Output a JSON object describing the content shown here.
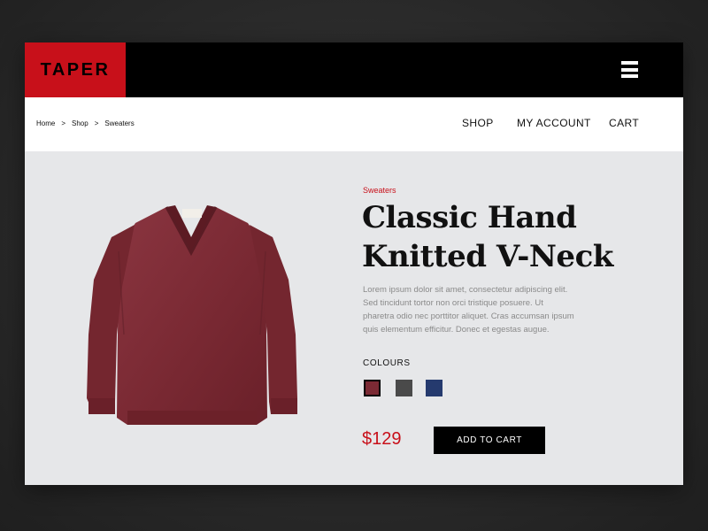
{
  "brand": {
    "logo_text": "TAPER",
    "accent_color": "#c8101a"
  },
  "header": {
    "menu_icon": "hamburger-menu-icon"
  },
  "breadcrumb": {
    "items": [
      "Home",
      "Shop",
      "Sweaters"
    ],
    "separator": ">"
  },
  "nav": {
    "items": [
      "SHOP",
      "MY ACCOUNT",
      "CART"
    ]
  },
  "product": {
    "category": "Sweaters",
    "title_line1": "Classic Hand",
    "title_line2": "Knitted V-Neck",
    "description": "Lorem ipsum dolor sit amet, consectetur adipiscing elit. Sed tincidunt tortor non orci tristique posuere. Ut pharetra odio nec porttitor aliquet. Cras accumsan ipsum quis elementum efficitur. Donec et egestas augue.",
    "colours_label": "COLOURS",
    "colours": [
      {
        "name": "burgundy",
        "hex": "#7b2a34",
        "selected": true
      },
      {
        "name": "charcoal",
        "hex": "#4a4a4a",
        "selected": false
      },
      {
        "name": "navy",
        "hex": "#253a6e",
        "selected": false
      }
    ],
    "price": "$129",
    "add_to_cart_label": "ADD TO CART",
    "image_icon": "sweater-product-image"
  }
}
